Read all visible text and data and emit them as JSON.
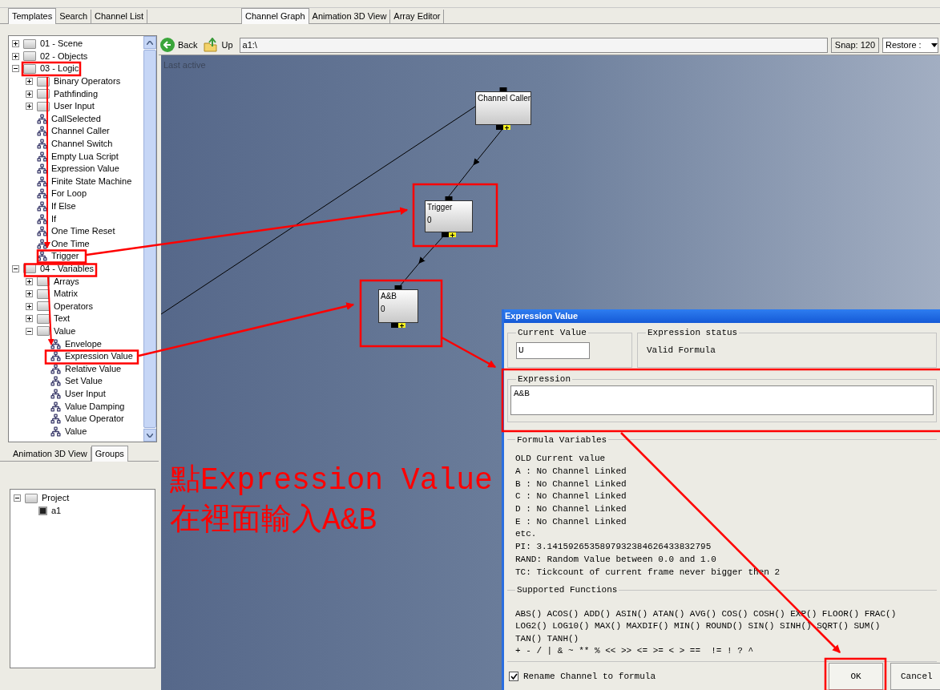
{
  "left_tabs": [
    {
      "label": "Templates",
      "selected": true
    },
    {
      "label": "Search",
      "selected": false
    },
    {
      "label": "Channel List",
      "selected": false
    }
  ],
  "template_tree": [
    {
      "label": "01 - Scene",
      "kind": "folder",
      "expanded": false
    },
    {
      "label": "02 - Objects",
      "kind": "folder",
      "expanded": false
    },
    {
      "label": "03 - Logic",
      "kind": "folder",
      "expanded": true,
      "children": [
        {
          "label": "Binary Operators",
          "kind": "folder",
          "expanded": false
        },
        {
          "label": "Pathfinding",
          "kind": "folder",
          "expanded": false
        },
        {
          "label": "User Input",
          "kind": "folder",
          "expanded": false
        },
        {
          "label": "CallSelected",
          "kind": "node"
        },
        {
          "label": "Channel Caller",
          "kind": "node"
        },
        {
          "label": "Channel Switch",
          "kind": "node"
        },
        {
          "label": "Empty Lua Script",
          "kind": "node"
        },
        {
          "label": "Expression Value",
          "kind": "node"
        },
        {
          "label": "Finite State Machine",
          "kind": "node"
        },
        {
          "label": "For Loop",
          "kind": "node"
        },
        {
          "label": "If Else",
          "kind": "node"
        },
        {
          "label": "If",
          "kind": "node"
        },
        {
          "label": "One Time Reset",
          "kind": "node"
        },
        {
          "label": "One Time",
          "kind": "node"
        },
        {
          "label": "Trigger",
          "kind": "node"
        }
      ]
    },
    {
      "label": "04 - Variables",
      "kind": "folder",
      "expanded": true,
      "children": [
        {
          "label": "Arrays",
          "kind": "folder",
          "expanded": false
        },
        {
          "label": "Matrix",
          "kind": "folder",
          "expanded": false
        },
        {
          "label": "Operators",
          "kind": "folder",
          "expanded": false
        },
        {
          "label": "Text",
          "kind": "folder",
          "expanded": false
        },
        {
          "label": "Value",
          "kind": "folder",
          "expanded": true,
          "children": [
            {
              "label": "Envelope",
              "kind": "node"
            },
            {
              "label": "Expression Value",
              "kind": "node"
            },
            {
              "label": "Relative Value",
              "kind": "node"
            },
            {
              "label": "Set Value",
              "kind": "node"
            },
            {
              "label": "User Input",
              "kind": "node"
            },
            {
              "label": "Value Damping",
              "kind": "node"
            },
            {
              "label": "Value Operator",
              "kind": "node"
            },
            {
              "label": "Value",
              "kind": "node"
            }
          ]
        }
      ]
    }
  ],
  "bottom_tabs": [
    {
      "label": "Animation 3D View",
      "selected": false
    },
    {
      "label": "Groups",
      "selected": true
    }
  ],
  "groups_tree": [
    {
      "label": "Project",
      "kind": "folder",
      "expanded": true,
      "children": [
        {
          "label": "a1",
          "kind": "channel"
        }
      ]
    }
  ],
  "view_tabs": [
    {
      "label": "Channel Graph",
      "selected": true
    },
    {
      "label": "Animation 3D View",
      "selected": false
    },
    {
      "label": "Array Editor",
      "selected": false
    }
  ],
  "toolbar": {
    "back": "Back",
    "up": "Up",
    "path": "a1:\\",
    "snap": "Snap: 120",
    "restore": "Restore :"
  },
  "canvas": {
    "status": "Last active",
    "nodes": [
      {
        "title": "Channel Caller"
      },
      {
        "title": "Trigger",
        "value": "0"
      },
      {
        "title": "A&B",
        "value": "0"
      }
    ]
  },
  "dialog": {
    "title": "Expression Value",
    "current_value_label": "Current Value",
    "current_value": "U",
    "status_label": "Expression status",
    "status": "Valid Formula",
    "expression_label": "Expression",
    "expression": "A&B",
    "variables_label": "Formula Variables",
    "variables": [
      "OLD Current value",
      "A : No Channel Linked",
      "B : No Channel Linked",
      "C : No Channel Linked",
      "D : No Channel Linked",
      "E : No Channel Linked",
      "etc.",
      "PI: 3.1415926535897932384626433832795",
      "RAND: Random Value between 0.0 and 1.0",
      "TC: Tickcount of current frame never bigger then 2"
    ],
    "functions_label": "Supported Functions",
    "functions": [
      "ABS() ACOS() ADD() ASIN() ATAN() AVG() COS() COSH() EXP() FLOOR() FRAC()",
      "LOG2() LOG10() MAX() MAXDIF() MIN() ROUND() SIN() SINH() SQRT() SUM()",
      "TAN() TANH()",
      "+ - / | & ~ ** % << >> <= >= < > ==  != ! ? ^"
    ],
    "rename": {
      "label": "Rename Channel to formula",
      "checked": true
    },
    "ok": "OK",
    "cancel": "Cancel"
  },
  "annotation": [
    "點Expression Value",
    "在裡面輸入A&B"
  ]
}
